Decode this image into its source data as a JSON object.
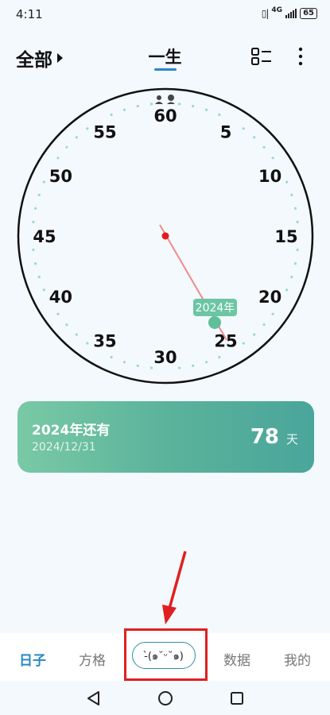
{
  "status_bar": {
    "time": "4:11",
    "network": "4G",
    "battery": "65"
  },
  "header": {
    "filter_label": "全部",
    "view_title": "一生"
  },
  "clock": {
    "numbers": [
      "60",
      "5",
      "10",
      "15",
      "20",
      "25",
      "30",
      "35",
      "40",
      "45",
      "50",
      "55"
    ],
    "year_label": "2024年"
  },
  "countdown": {
    "title": "2024年还有",
    "date": "2024/12/31",
    "days": "78",
    "unit": "天"
  },
  "tabs": [
    {
      "label": "日子",
      "active": true
    },
    {
      "label": "方格"
    },
    {
      "label": "-̀(๑˘ᵕ˘๑)"
    },
    {
      "label": "数据"
    },
    {
      "label": "我的"
    }
  ],
  "colors": {
    "accent": "#2a88c7",
    "card_green": "#5bb39b",
    "highlight_red": "#e02020",
    "hand_red": "#f08a8a"
  }
}
